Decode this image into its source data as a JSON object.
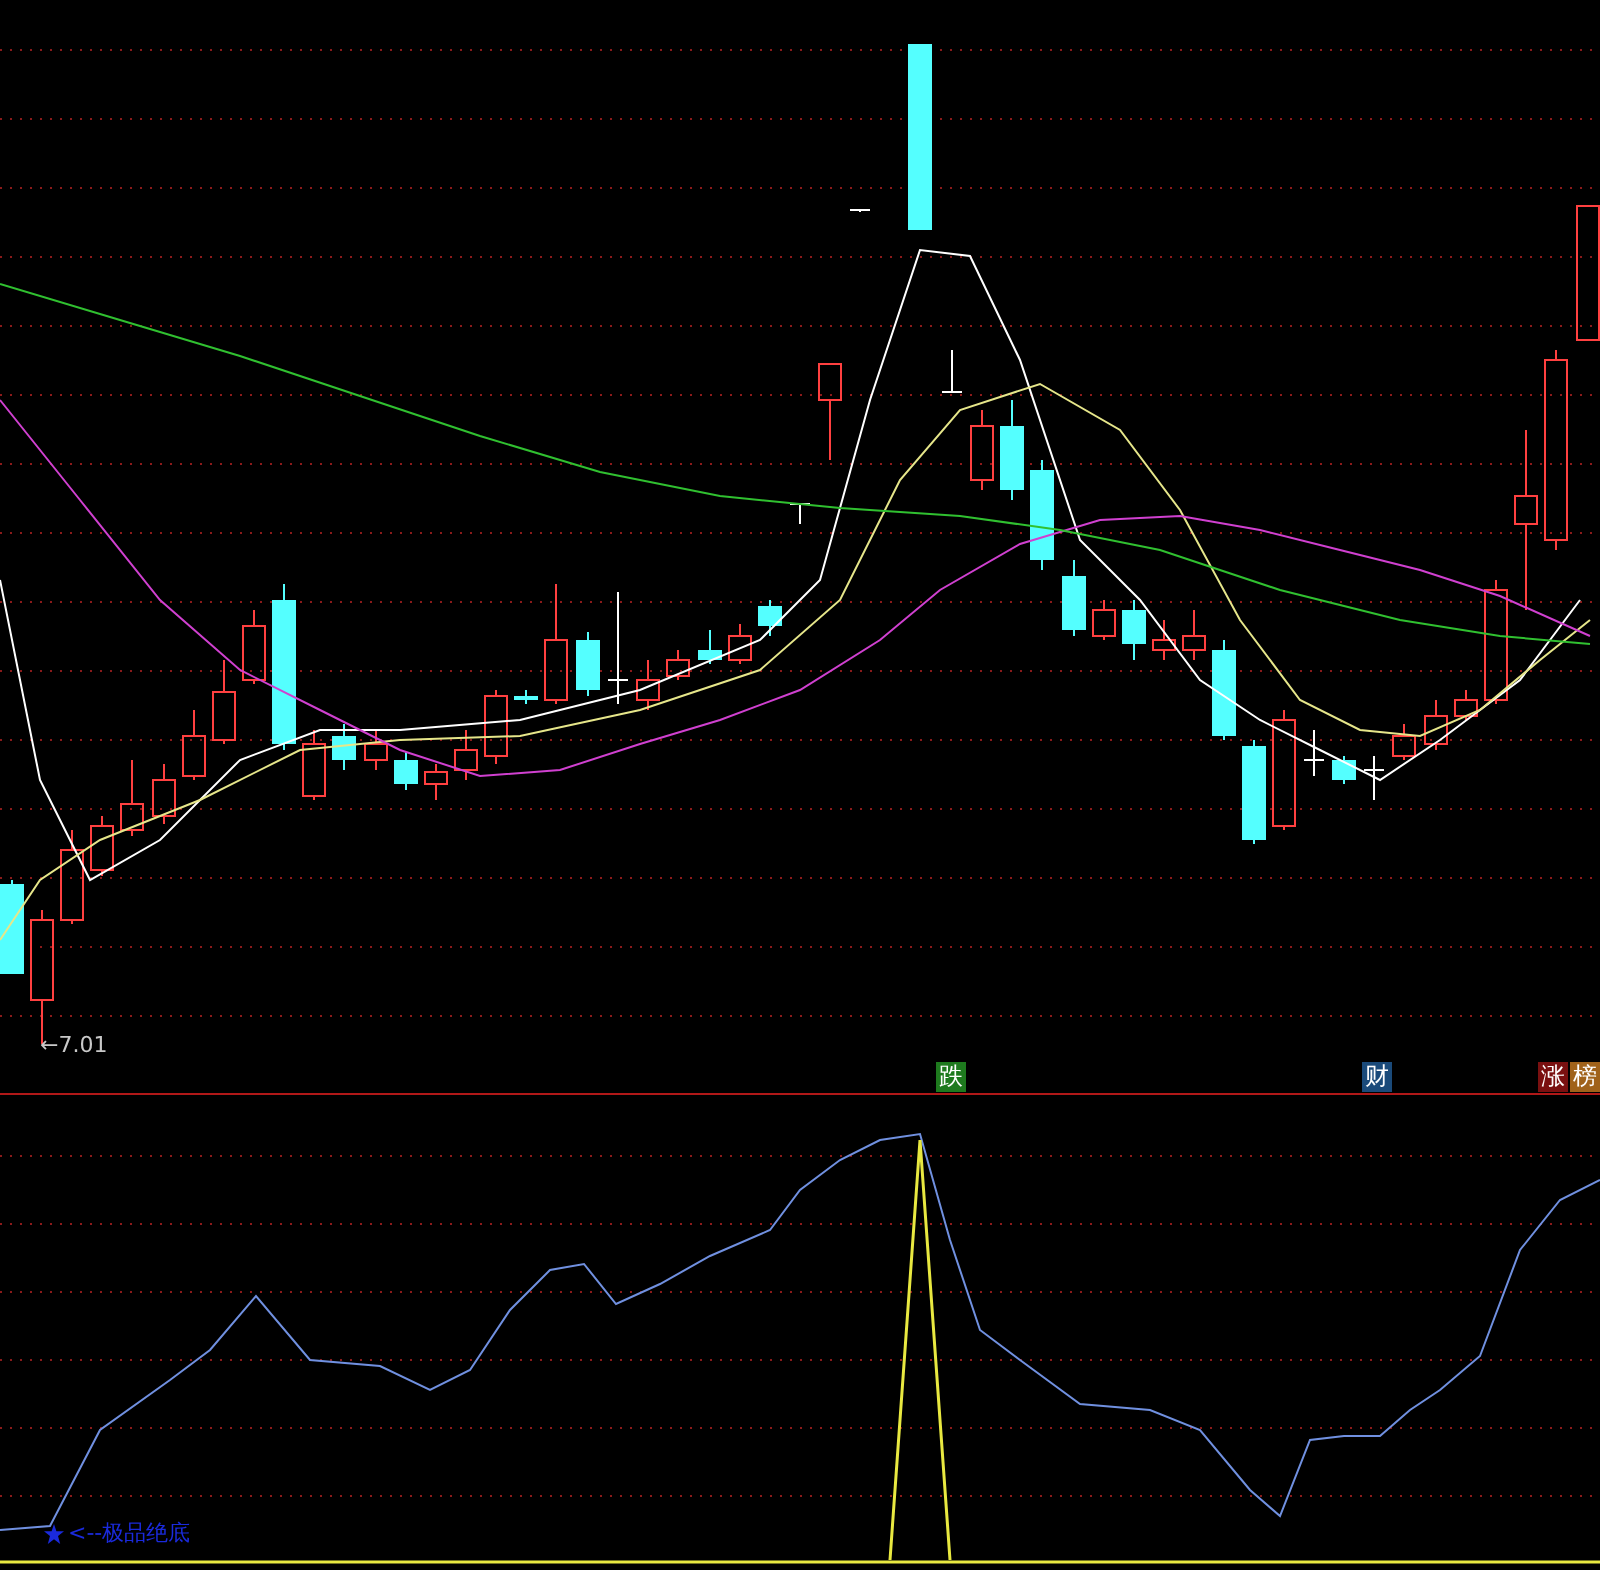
{
  "price_panel": {
    "low_label": "←7.01"
  },
  "signal_badges": [
    {
      "text": "跌",
      "color": "#1e7a1e"
    },
    {
      "text": "财",
      "color": "#1a4a7a"
    },
    {
      "text": "涨",
      "color": "#7a1010"
    },
    {
      "text": "榜",
      "color": "#a0621a"
    }
  ],
  "indicator_panel": {
    "label": "<--极品绝底"
  }
}
